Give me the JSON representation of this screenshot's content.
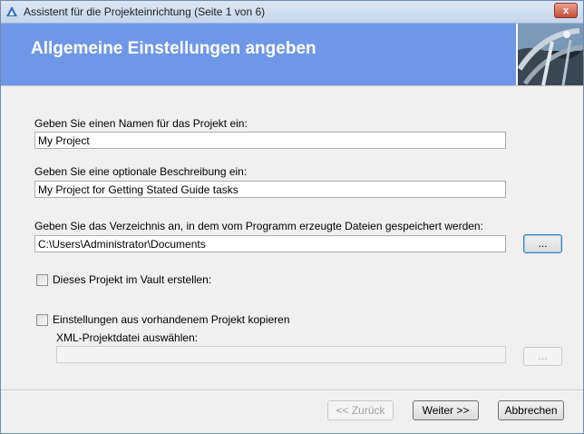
{
  "window": {
    "title": "Assistent für die Projekteinrichtung (Seite 1 von 6)",
    "close_label": "x"
  },
  "header": {
    "title": "Allgemeine Einstellungen angeben"
  },
  "form": {
    "name_label": "Geben Sie einen Namen für das Projekt ein:",
    "name_value": "My Project",
    "description_label": "Geben Sie eine optionale Beschreibung ein:",
    "description_value": "My Project for Getting Stated Guide tasks",
    "directory_label": "Geben Sie das Verzeichnis an, in dem vom Programm erzeugte Dateien gespeichert werden:",
    "directory_value": "C:\\Users\\Administrator\\Documents",
    "browse_label": "...",
    "vault_checkbox_label": "Dieses Projekt im Vault erstellen:",
    "vault_checked": false,
    "copy_checkbox_label": "Einstellungen aus vorhandenem Projekt kopieren",
    "copy_checked": false,
    "xml_label": "XML-Projektdatei auswählen:",
    "xml_value": "",
    "xml_browse_label": "..."
  },
  "footer": {
    "back_label": "<< Zurück",
    "next_label": "Weiter >>",
    "cancel_label": "Abbrechen"
  },
  "colors": {
    "header_bg": "#6e97e8",
    "header_text": "#ffffff"
  }
}
